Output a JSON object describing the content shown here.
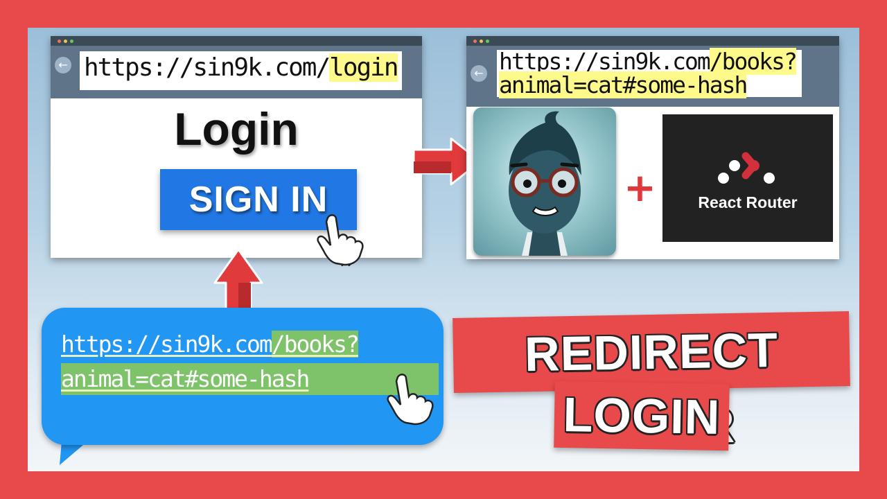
{
  "colors": {
    "frame": "#e8494a",
    "button_blue": "#2177e3",
    "bubble_blue": "#2196f3",
    "highlight_yellow": "#fdf98b",
    "highlight_green": "#7ec26a"
  },
  "login_window": {
    "url_base": "https://sin9k.com/",
    "url_highlight": "login",
    "title": "Login",
    "button_label": "SIGN IN",
    "back_icon": "arrow-left-icon"
  },
  "result_window": {
    "url_base": "https://sin9k.com",
    "url_highlight_1": "/books?",
    "url_highlight_2": "animal=cat#some-hash",
    "plus": "+",
    "logo_text": "React Router",
    "back_icon": "arrow-left-icon"
  },
  "bubble": {
    "url_base": "https://sin9k.com",
    "url_highlight_1": "/books?",
    "url_line_2": "animal=cat#some-hash"
  },
  "title": {
    "line1": "REDIRECT AFTER",
    "line2": "LOGIN"
  },
  "icons": [
    "pointer-hand-icon",
    "arrow-right-icon",
    "arrow-up-icon"
  ]
}
